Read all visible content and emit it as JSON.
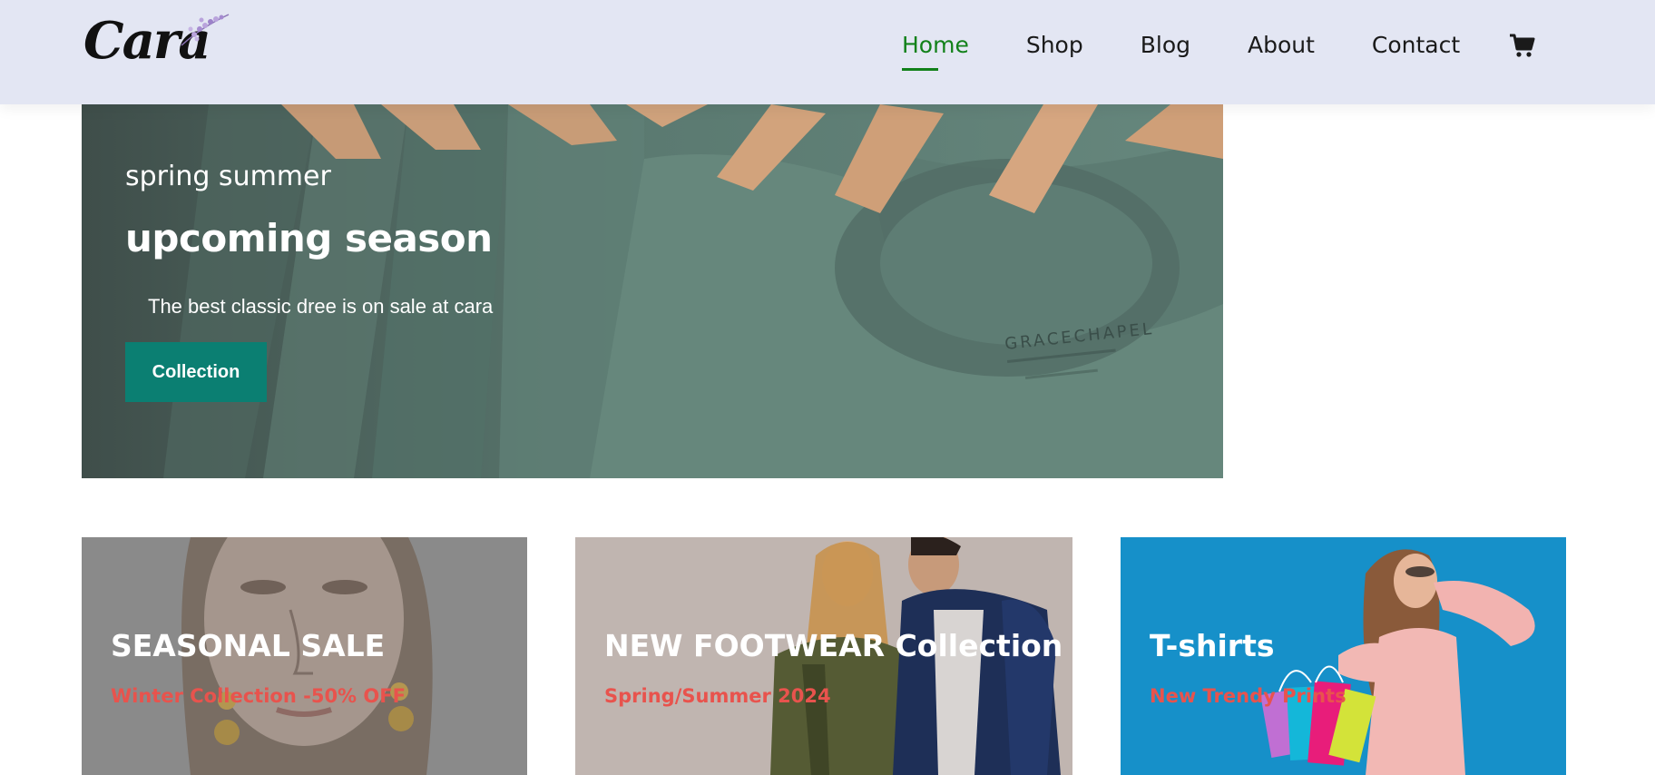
{
  "brand": {
    "logo_text": "Cara"
  },
  "nav": {
    "items": [
      {
        "label": "Home",
        "active": true
      },
      {
        "label": "Shop",
        "active": false
      },
      {
        "label": "Blog",
        "active": false
      },
      {
        "label": "About",
        "active": false
      },
      {
        "label": "Contact",
        "active": false
      }
    ],
    "cart_icon": "shopping-cart-icon"
  },
  "hero": {
    "subtitle": "spring summer",
    "title": "upcoming season",
    "text": "The best classic dree is on sale at cara",
    "button_label": "Collection"
  },
  "banners": [
    {
      "title": "SEASONAL SALE",
      "subtitle": "Winter Collection -50% OFF"
    },
    {
      "title": "NEW FOOTWEAR Collection",
      "subtitle": "Spring/Summer 2024"
    },
    {
      "title": "T-shirts",
      "subtitle": "New Trendy Prints"
    }
  ],
  "colors": {
    "header_bg": "#e3e6f3",
    "accent": "#088178",
    "active_nav": "#12811a",
    "banner_subtitle": "#e8534d"
  }
}
